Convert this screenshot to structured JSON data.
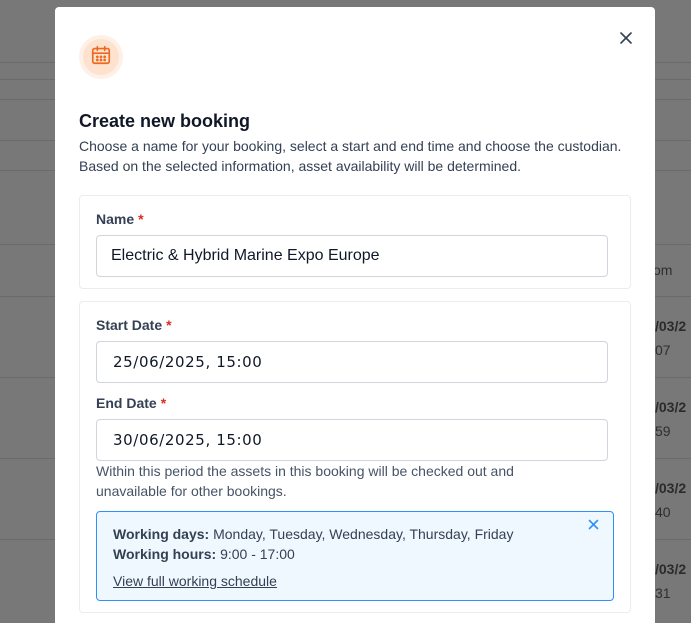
{
  "background": {
    "fragments": [
      {
        "text": "om",
        "bold": false
      },
      {
        "text": "/03/2",
        "bold": true
      },
      {
        "text": "07",
        "bold": false
      },
      {
        "text": "/03/2",
        "bold": true
      },
      {
        "text": "59",
        "bold": false
      },
      {
        "text": "/03/2",
        "bold": true
      },
      {
        "text": "40",
        "bold": false
      },
      {
        "text": "/03/2",
        "bold": true
      },
      {
        "text": "31",
        "bold": false
      }
    ]
  },
  "modal": {
    "icon": "calendar-icon",
    "close_icon": "close-icon",
    "title": "Create new booking",
    "description": "Choose a name for your booking, select a start and end time and choose the custodian. Based on the selected information, asset availability will be determined.",
    "name_field": {
      "label": "Name",
      "required_mark": "*",
      "value": "Electric & Hybrid Marine Expo Europe"
    },
    "start_date": {
      "label": "Start Date",
      "required_mark": "*",
      "value": "25/06/2025, 15:00"
    },
    "end_date": {
      "label": "End Date",
      "required_mark": "*",
      "value": "30/06/2025, 15:00"
    },
    "helper_text": "Within this period the assets in this booking will be checked out and unavailable for other bookings.",
    "working_info": {
      "days_label": "Working days:",
      "days_value": "Monday, Tuesday, Wednesday, Thursday, Friday",
      "hours_label": "Working hours:",
      "hours_value": "9:00 - 17:00",
      "link_text": "View full working schedule",
      "accent_color": "#2e90fa"
    }
  },
  "colors": {
    "accent_orange": "#ef6820",
    "required_red": "#d92d20",
    "info_bg": "#eff8ff",
    "info_border": "#2e90fa"
  }
}
